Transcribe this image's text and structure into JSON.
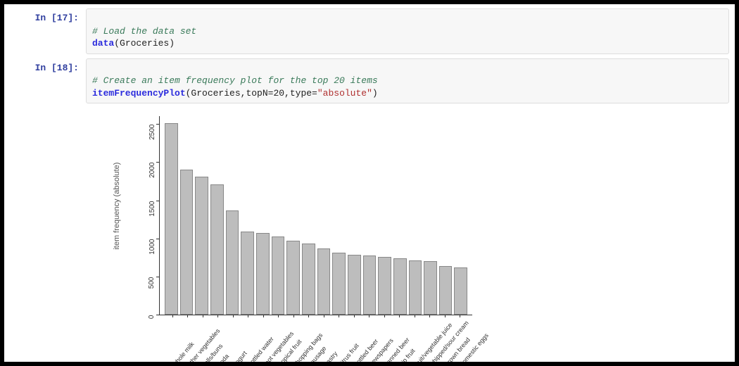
{
  "cells": {
    "c17": {
      "prompt": "In [17]:",
      "comment": "# Load the data set",
      "func": "data",
      "args_plain": "(Groceries)"
    },
    "c18": {
      "prompt": "In [18]:",
      "comment": "# Create an item frequency plot for the top 20 items",
      "func": "itemFrequencyPlot",
      "args_prefix": "(Groceries,topN=20,type=",
      "args_str": "\"absolute\"",
      "args_suffix": ")"
    }
  },
  "chart_data": {
    "type": "bar",
    "ylabel": "item frequency (absolute)",
    "ylim": [
      0,
      2600
    ],
    "yticks": [
      0,
      500,
      1000,
      1500,
      2000,
      2500
    ],
    "categories": [
      "whole milk",
      "other vegetables",
      "rolls/buns",
      "soda",
      "yogurt",
      "bottled water",
      "root vegetables",
      "tropical fruit",
      "shopping bags",
      "sausage",
      "pastry",
      "citrus fruit",
      "bottled beer",
      "newspapers",
      "canned beer",
      "pip fruit",
      "fruit/vegetable juice",
      "whipped/sour cream",
      "brown bread",
      "domestic eggs"
    ],
    "values": [
      2510,
      1900,
      1810,
      1710,
      1370,
      1090,
      1070,
      1030,
      970,
      930,
      870,
      810,
      790,
      780,
      760,
      740,
      710,
      700,
      640,
      620
    ]
  }
}
